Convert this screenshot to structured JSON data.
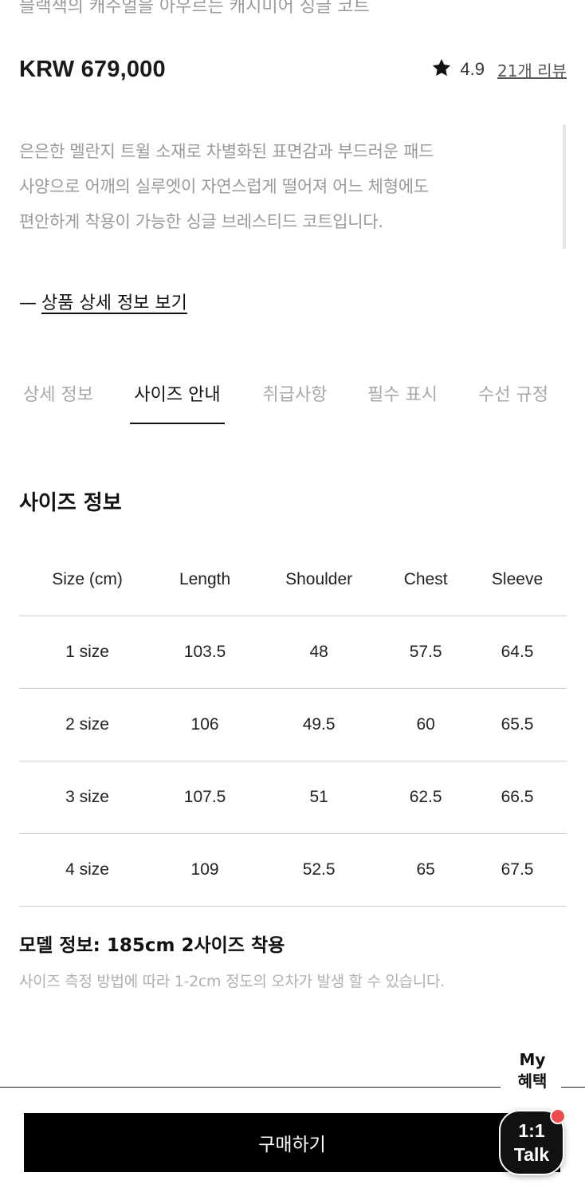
{
  "product": {
    "cut_line": "블랙색의 캐주얼을 아우르는 캐시미어 싱글 코트",
    "price": "KRW 679,000",
    "rating": "4.9",
    "review_link": "21개 리뷰",
    "description_lines": [
      "은은한 멜란지 트윌 소재로 차별화된 표면감과 부드러운 패드",
      "사양으로 어깨의 실루엣이 자연스럽게 떨어져 어느 체형에도",
      "편안하게 착용이 가능한 싱글 브레스티드 코트입니다."
    ],
    "detail_link_dash": "—",
    "detail_link": "상품 상세 정보 보기"
  },
  "tabs": [
    {
      "label": "상세 정보",
      "active": false
    },
    {
      "label": "사이즈 안내",
      "active": true
    },
    {
      "label": "취급사항",
      "active": false
    },
    {
      "label": "필수 표시",
      "active": false
    },
    {
      "label": "수선 규정",
      "active": false
    }
  ],
  "size_info": {
    "title": "사이즈 정보",
    "columns": [
      "Size (cm)",
      "Length",
      "Shoulder",
      "Chest",
      "Sleeve"
    ],
    "rows": [
      [
        "1 size",
        "103.5",
        "48",
        "57.5",
        "64.5"
      ],
      [
        "2 size",
        "106",
        "49.5",
        "60",
        "65.5"
      ],
      [
        "3 size",
        "107.5",
        "51",
        "62.5",
        "66.5"
      ],
      [
        "4 size",
        "109",
        "52.5",
        "65",
        "67.5"
      ]
    ],
    "model_info": "모델 정보: 185cm 2사이즈 착용",
    "notice": "사이즈 측정 방법에 따라 1-2cm 정도의 오차가 발생 할 수 있습니다."
  },
  "floating": {
    "my_benefit_line1": "My",
    "my_benefit_line2": "혜택",
    "talk_line1": "1:1",
    "talk_line2": "Talk"
  },
  "footer": {
    "buy_label": "구매하기"
  },
  "icons": {
    "rating": "star-icon"
  },
  "colors": {
    "primary": "#000000",
    "muted_text": "#9a9a9a",
    "badge": "#ef4c4c"
  }
}
